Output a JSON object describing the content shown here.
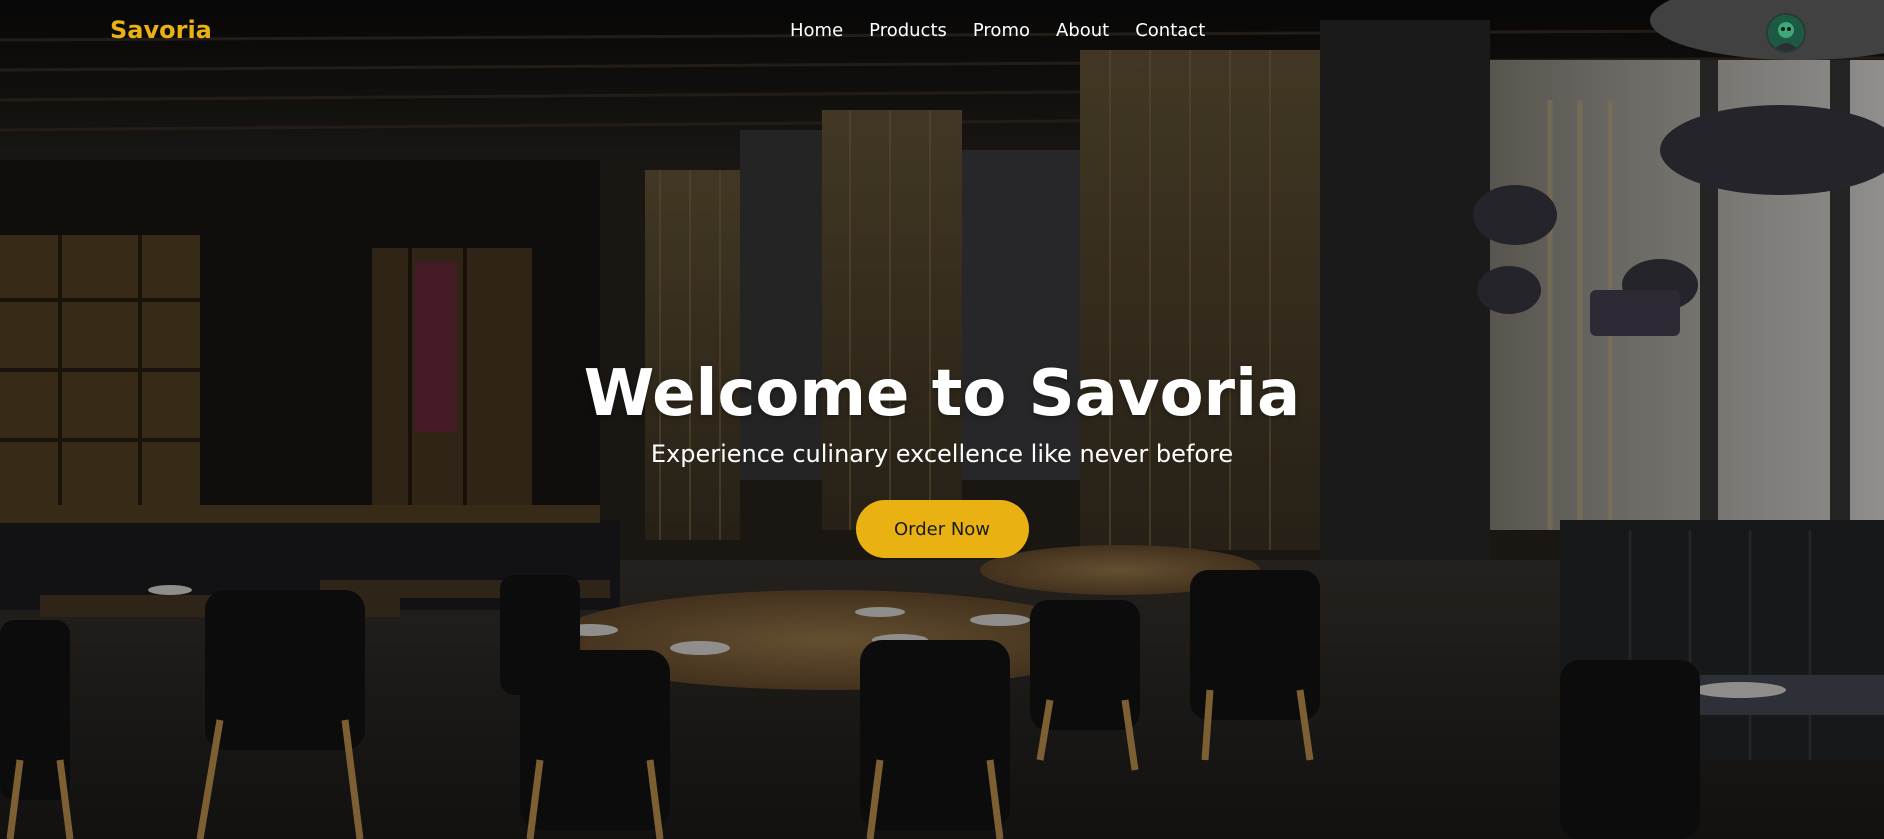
{
  "navbar": {
    "brand": "Savoria",
    "links": [
      {
        "label": "Home"
      },
      {
        "label": "Products"
      },
      {
        "label": "Promo"
      },
      {
        "label": "About"
      },
      {
        "label": "Contact"
      }
    ],
    "avatar_icon": "user-avatar-icon"
  },
  "hero": {
    "title": "Welcome to Savoria",
    "subtitle": "Experience culinary excellence like never before",
    "cta_label": "Order Now"
  },
  "colors": {
    "accent": "#e9b212",
    "text": "#ffffff",
    "button_text": "#1b1b1b"
  }
}
